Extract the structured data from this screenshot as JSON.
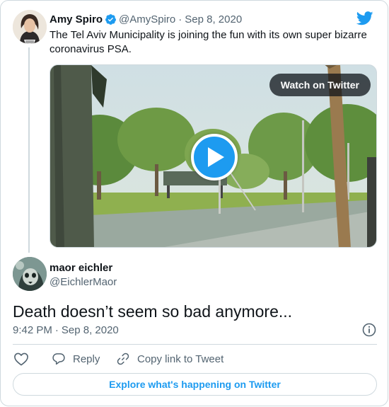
{
  "parent_tweet": {
    "author_name": "Amy Spiro",
    "handle": "@AmySpiro",
    "separator": "·",
    "date": "Sep 8, 2020",
    "text": "The Tel Aviv Municipality is joining the fun with its own super bizarre coronavirus PSA.",
    "video": {
      "watch_label": "Watch on Twitter"
    }
  },
  "main_tweet": {
    "author_name": "maor eichler",
    "handle": "@EichlerMaor",
    "text": "Death doesn’t seem so bad anymore...",
    "time": "9:42 PM",
    "separator": "·",
    "date": "Sep 8, 2020"
  },
  "actions": {
    "reply_label": "Reply",
    "copy_label": "Copy link to Tweet"
  },
  "explore_label": "Explore what's happening on Twitter",
  "colors": {
    "brand_blue": "#1d9bf0",
    "text_primary": "#0f1419",
    "text_secondary": "#536471",
    "border": "#cfd9de"
  },
  "icons": {
    "brand": "twitter-bird-icon",
    "verified": "verified-badge-icon",
    "play": "play-icon",
    "info": "info-icon",
    "like": "heart-icon",
    "reply": "reply-bubble-icon",
    "copy": "link-icon"
  }
}
